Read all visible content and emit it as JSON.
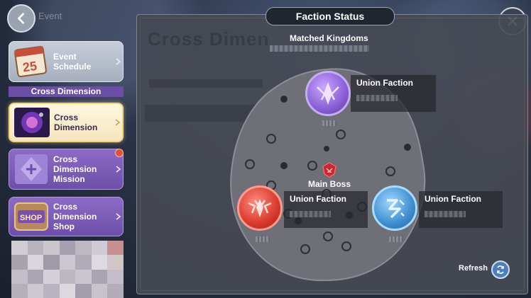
{
  "header": {
    "back_label": "Event"
  },
  "sidebar": {
    "items": [
      {
        "label": "Event\nSchedule",
        "icon": "calendar-icon",
        "icon_text": "25"
      },
      {
        "label": "Cross\nDimension",
        "icon": "cross-dimension-icon",
        "selected": true
      },
      {
        "label": "Cross\nDimension\nMission",
        "icon": "mission-icon",
        "badge": true
      },
      {
        "label": "Cross\nDimension\nShop",
        "icon": "shop-icon",
        "icon_text": "SHOP"
      }
    ],
    "section_header": "Cross Dimension"
  },
  "panel": {
    "title": "Faction Status",
    "matched_label": "Matched Kingdoms",
    "boss_label": "Main Boss",
    "factions": [
      {
        "name": "Union Faction",
        "color": "#8a5fd6"
      },
      {
        "name": "Union Faction",
        "color": "#d9392e"
      },
      {
        "name": "Union Faction",
        "color": "#3f8ecf"
      }
    ],
    "refresh_label": "Refresh"
  },
  "colors": {
    "accent": "#6b4fa6",
    "selected_border": "#f2d37a",
    "badge": "#e0513a"
  }
}
